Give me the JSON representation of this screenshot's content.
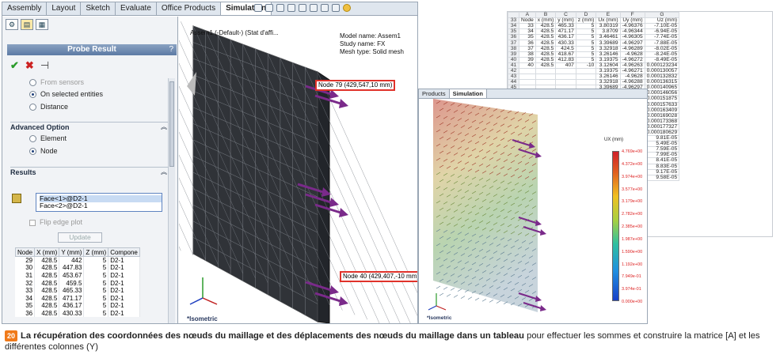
{
  "main_window": {
    "tabs": [
      "Assembly",
      "Layout",
      "Sketch",
      "Evaluate",
      "Office Products",
      "Simulation"
    ],
    "active_tab": "Simulation",
    "probe_panel": {
      "title": "Probe Result",
      "help": "?",
      "options_top": [
        {
          "label": "From sensors",
          "selected": false,
          "disabled": true
        },
        {
          "label": "On selected entities",
          "selected": true,
          "disabled": false
        },
        {
          "label": "Distance",
          "selected": false,
          "disabled": false
        }
      ],
      "advanced_title": "Advanced Option",
      "advanced_options": [
        {
          "label": "Element",
          "selected": false
        },
        {
          "label": "Node",
          "selected": true
        }
      ],
      "results_title": "Results",
      "faces": [
        "Face<1>@D2-1",
        "Face<2>@D2-1"
      ],
      "flip_edge_plot": "Flip edge plot",
      "update_label": "Update",
      "table": {
        "headers": [
          "Node",
          "X (mm)",
          "Y (mm)",
          "Z (mm)",
          "Compone"
        ],
        "rows": [
          [
            "29",
            "428.5",
            "442",
            "5",
            "D2-1"
          ],
          [
            "30",
            "428.5",
            "447.83",
            "5",
            "D2-1"
          ],
          [
            "31",
            "428.5",
            "453.67",
            "5",
            "D2-1"
          ],
          [
            "32",
            "428.5",
            "459.5",
            "5",
            "D2-1"
          ],
          [
            "33",
            "428.5",
            "465.33",
            "5",
            "D2-1"
          ],
          [
            "34",
            "428.5",
            "471.17",
            "5",
            "D2-1"
          ],
          [
            "35",
            "428.5",
            "436.17",
            "5",
            "D2-1"
          ],
          [
            "36",
            "428.5",
            "430.33",
            "5",
            "D2-1"
          ]
        ]
      }
    },
    "viewport": {
      "tree_label": "Assem1 (-Default-) (Stat d'affi...",
      "model_name": "Model name: Assem1",
      "study_name": "Study name: FX",
      "mesh_type": "Mesh type: Solid mesh",
      "callout_top": "Node 79 (429,547,10 mm)",
      "callout_bottom": "Node 40 (429,407,-10 mm)",
      "view_label": "*Isometric"
    }
  },
  "spreadsheet": {
    "columns": [
      "",
      "A",
      "B",
      "C",
      "D",
      "E",
      "F",
      "G"
    ],
    "header_row": [
      "33",
      "Node",
      "x (mm)",
      "y (mm)",
      "z (mm)",
      "Ux (mm)",
      "Uy (mm)",
      "Uz (mm)"
    ],
    "rows": [
      [
        "34",
        "33",
        "428.5",
        "465.33",
        "5",
        "3.80319",
        "-4.96376",
        "-7.10E-05"
      ],
      [
        "35",
        "34",
        "428.5",
        "471.17",
        "5",
        "3.8709",
        "-4.96344",
        "-6.94E-05"
      ],
      [
        "36",
        "35",
        "428.5",
        "436.17",
        "5",
        "3.46461",
        "-4.96305",
        "-7.74E-05"
      ],
      [
        "37",
        "36",
        "428.5",
        "430.33",
        "5",
        "3.39689",
        "-4.96297",
        "-7.88E-05"
      ],
      [
        "38",
        "37",
        "428.5",
        "424.5",
        "5",
        "3.32918",
        "-4.96289",
        "-8.02E-05"
      ],
      [
        "39",
        "38",
        "428.5",
        "418.67",
        "5",
        "3.26146",
        "-4.9628",
        "-8.24E-05"
      ],
      [
        "40",
        "39",
        "428.5",
        "412.83",
        "5",
        "3.19375",
        "-4.96272",
        "-8.49E-05"
      ],
      [
        "41",
        "40",
        "428.5",
        "407",
        "-10",
        "3.12604",
        "-4.96263",
        "0.000123234"
      ],
      [
        "42",
        "",
        "",
        "",
        "",
        "3.19375",
        "-4.96271",
        "0.000130057"
      ],
      [
        "43",
        "",
        "",
        "",
        "",
        "3.26146",
        "-4.9628",
        "0.000132832"
      ],
      [
        "44",
        "",
        "",
        "",
        "",
        "3.32918",
        "-4.96288",
        "0.000136315"
      ],
      [
        "45",
        "",
        "",
        "",
        "",
        "3.39689",
        "-4.96297",
        "0.000140965"
      ],
      [
        "46",
        "",
        "",
        "",
        "",
        "3.46461",
        "-4.96305",
        "0.000146056"
      ],
      [
        "47",
        "",
        "",
        "",
        "",
        "3.53233",
        "-4.96312",
        "0.000151875"
      ],
      [
        "48",
        "",
        "",
        "",
        "",
        "3.60005",
        "-4.96319",
        "0.000157633"
      ],
      [
        "49",
        "",
        "",
        "",
        "",
        "3.66777",
        "-4.96326",
        "0.000163409"
      ],
      [
        "50",
        "",
        "",
        "",
        "",
        "3.73549",
        "-4.96332",
        "0.000169028"
      ],
      [
        "51",
        "",
        "",
        "",
        "",
        "3.8032",
        "-4.96338",
        "0.000173368"
      ],
      [
        "52",
        "",
        "",
        "",
        "",
        "3.8709",
        "-4.96344",
        "0.000177327"
      ],
      [
        "53",
        "",
        "",
        "",
        "",
        "3.9386",
        "-4.96349",
        "0.000180629"
      ],
      [
        "54",
        "",
        "",
        "",
        "",
        "3.9386",
        "-4.9635",
        "9.81E-05"
      ],
      [
        "55",
        "",
        "",
        "",
        "",
        "3.12604",
        "-4.96263",
        "5.49E-05"
      ],
      [
        "56",
        "",
        "",
        "",
        "",
        "3.53233",
        "-4.96313",
        "7.59E-05"
      ],
      [
        "57",
        "",
        "",
        "",
        "",
        "3.60005",
        "-4.9632",
        "7.99E-05"
      ],
      [
        "58",
        "",
        "",
        "",
        "",
        "3.66777",
        "-4.96326",
        "8.41E-05"
      ],
      [
        "59",
        "",
        "",
        "",
        "",
        "3.73548",
        "-4.96332",
        "8.83E-05"
      ],
      [
        "60",
        "",
        "",
        "",
        "",
        "3.80319",
        "-4.96338",
        "9.17E-05"
      ],
      [
        "61",
        "",
        "",
        "",
        "",
        "3.8709",
        "-4.96344",
        "9.58E-05"
      ]
    ]
  },
  "window2": {
    "tabs": [
      "Products",
      "Simulation"
    ],
    "active_tab": "Simulation",
    "legend_title": "UX (mm)",
    "legend_ticks": [
      "4.769e+00",
      "4.372e+00",
      "3.974e+00",
      "3.577e+00",
      "3.179e+00",
      "2.782e+00",
      "2.385e+00",
      "1.987e+00",
      "1.590e+00",
      "1.192e+00",
      "7.949e-01",
      "3.974e-01",
      "0.000e+00"
    ],
    "view_label": "*Isometric"
  },
  "caption": {
    "number": "20",
    "bold": "La récupération des coordonnées des nœuds du maillage et des déplacements des nœuds du maillage dans un tableau",
    "rest": " pour effectuer les sommes et construire la matrice [A] et les différentes colonnes (Y)"
  },
  "colors": {
    "accent": "#e0322a",
    "caption_badge": "#f07a1a",
    "arrow": "#7a2a8a",
    "mesh": "#303338"
  }
}
